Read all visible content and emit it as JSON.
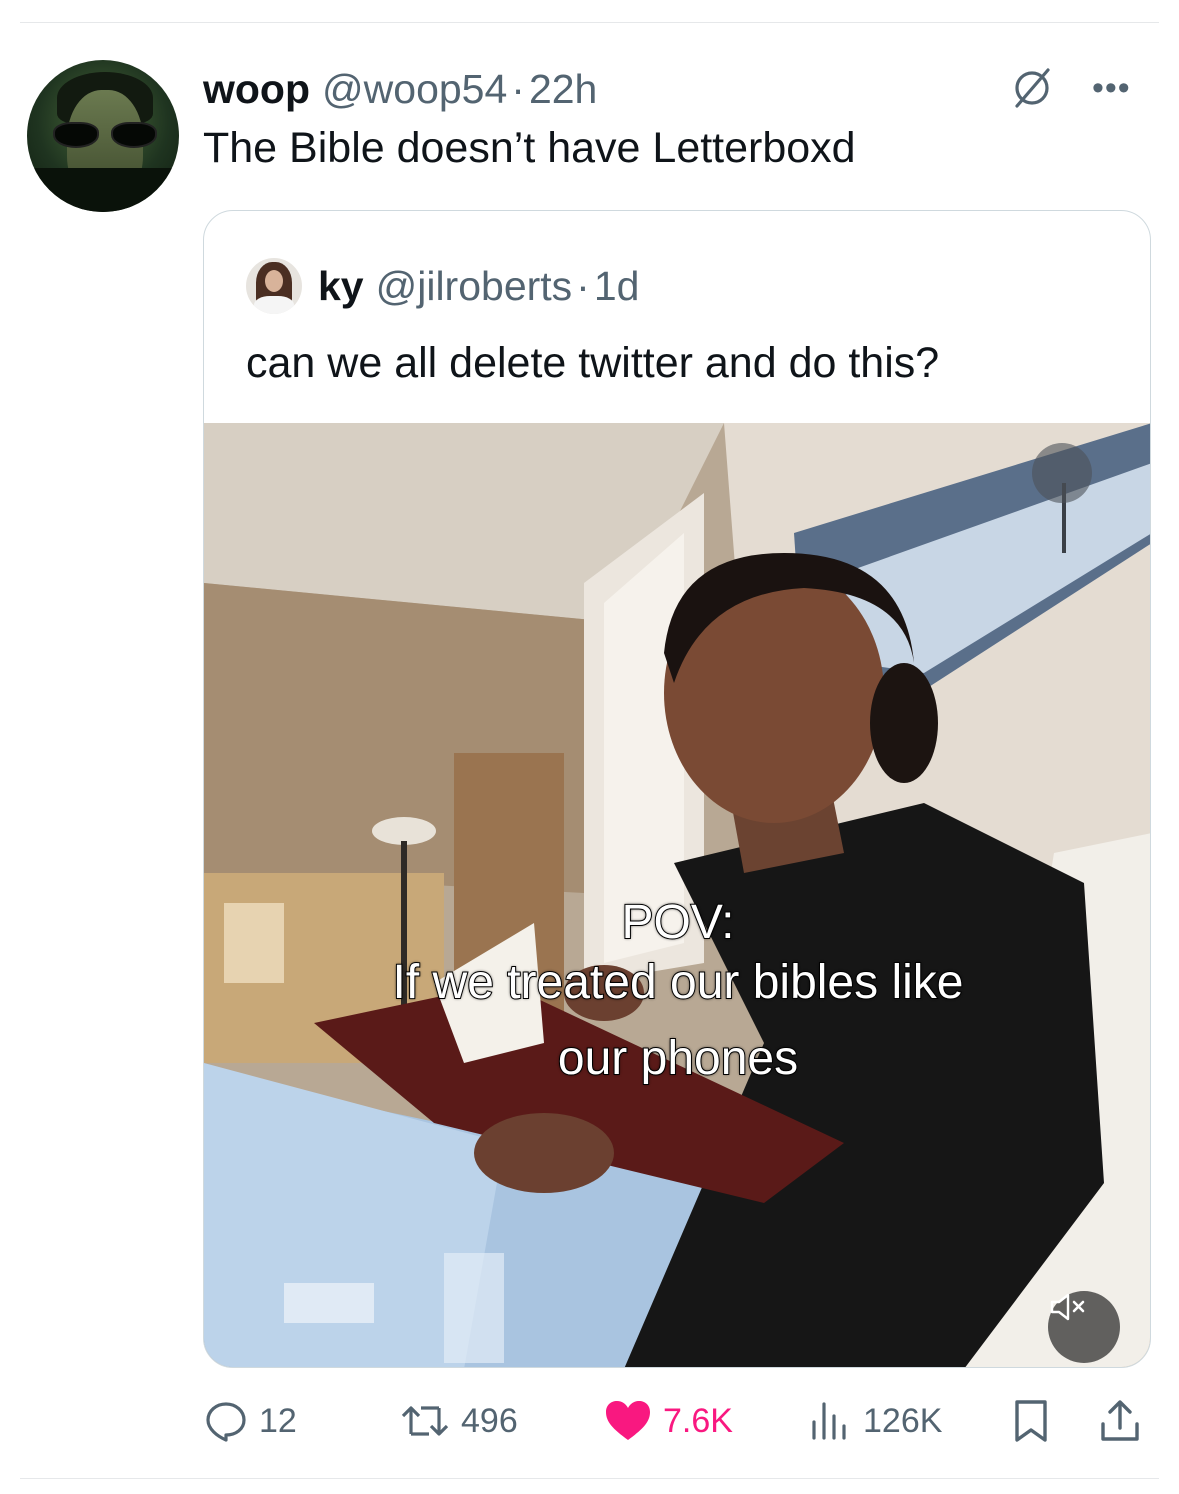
{
  "tweet": {
    "author": {
      "display_name": "woop",
      "handle": "@woop54",
      "separator": "·",
      "time": "22h"
    },
    "text": "The Bible doesn’t have Letterboxd",
    "menu_icon": "more-icon",
    "grok_icon": "grok-icon"
  },
  "quoted": {
    "author": {
      "display_name": "ky",
      "handle": "@jilroberts",
      "separator": "·",
      "time": "1d"
    },
    "text": "can we all delete twitter and do this?",
    "video": {
      "caption_line1": "POV:",
      "caption_line2": "If we treated our bibles like",
      "caption_line3": "our phones",
      "muted": true
    }
  },
  "actions": {
    "replies": "12",
    "reposts": "496",
    "likes": "7.6K",
    "views": "126K",
    "liked": true,
    "like_color": "#f91880",
    "icon_color": "#536471"
  }
}
